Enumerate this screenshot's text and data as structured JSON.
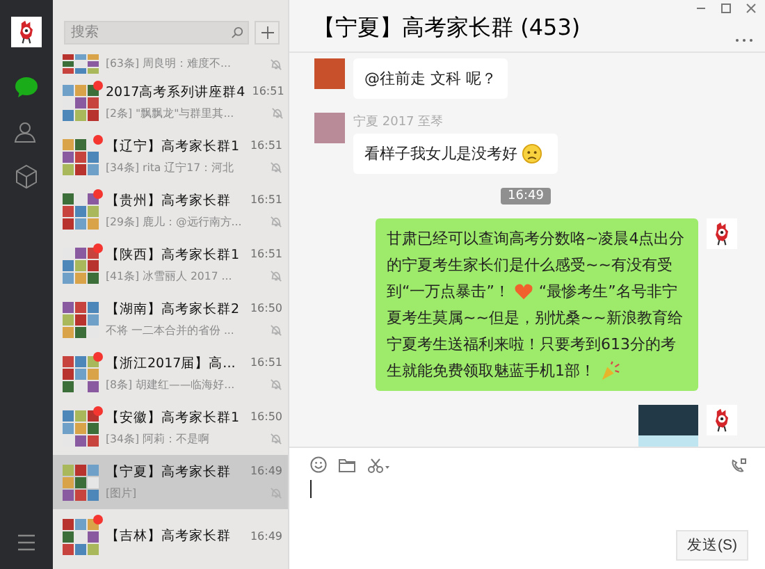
{
  "window": {
    "title": "【宁夏】高考家长群 (453)"
  },
  "search": {
    "placeholder": "搜索"
  },
  "chats": [
    {
      "kind": "partial",
      "preview": "[63条] 周良明：难度不...",
      "unread": false,
      "selected": false
    },
    {
      "kind": "full",
      "title": "2017高考系列讲座群4",
      "time": "16:51",
      "preview": "[2条] \"飘飘龙\"与群里其...",
      "unread": true,
      "selected": false
    },
    {
      "kind": "full",
      "title": "【辽宁】高考家长群1",
      "time": "16:51",
      "preview": "[34条] rita 辽宁17：河北",
      "unread": true,
      "selected": false
    },
    {
      "kind": "full",
      "title": "【贵州】高考家长群",
      "time": "16:51",
      "preview": "[29条] 鹿儿：@远行南方...",
      "unread": true,
      "selected": false
    },
    {
      "kind": "full",
      "title": "【陕西】高考家长群1",
      "time": "16:51",
      "preview": "[41条] 冰雪丽人  2017 ...",
      "unread": true,
      "selected": false
    },
    {
      "kind": "full",
      "title": "【湖南】高考家长群2",
      "time": "16:50",
      "preview": "不将 一二本合并的省份 ...",
      "unread": false,
      "selected": false
    },
    {
      "kind": "full",
      "title": "【浙江2017届】高...",
      "time": "16:51",
      "preview": "[8条] 胡建红——临海好...",
      "unread": true,
      "selected": false
    },
    {
      "kind": "full",
      "title": "【安徽】高考家长群1",
      "time": "16:50",
      "preview": "[34条] 阿莉：不是啊",
      "unread": true,
      "selected": false
    },
    {
      "kind": "full",
      "title": "【宁夏】高考家长群",
      "time": "16:49",
      "preview": "[图片]",
      "unread": false,
      "selected": true
    },
    {
      "kind": "full",
      "title": "【吉林】高考家长群",
      "time": "16:49",
      "unread": true,
      "selected": false
    }
  ],
  "messages": [
    {
      "kind": "text",
      "own": false,
      "parts": [
        {
          "kind": "text",
          "text": "@往前走 文科 呢？"
        }
      ]
    },
    {
      "kind": "text",
      "own": false,
      "sender": "宁夏 2017 至琴",
      "parts": [
        {
          "kind": "text",
          "text": "看样子我女儿是没考好"
        },
        {
          "kind": "sad"
        }
      ]
    },
    {
      "kind": "time",
      "text": "16:49"
    },
    {
      "kind": "text",
      "own": true,
      "parts": [
        {
          "kind": "text",
          "text": "甘肃已经可以查询高考分数咯~凌晨4点出分的宁夏考生家长们是什么感受~~有没有受到“一万点暴击”！"
        },
        {
          "kind": "heart"
        },
        {
          "kind": "text",
          "text": "“最惨考生”名号非宁夏考生莫属~~但是，别忧桑~~新浪教育给宁夏考生送福利来啦！只要考到613分的考生就能免费领取魅蓝手机1部！"
        },
        {
          "kind": "party"
        }
      ]
    },
    {
      "kind": "image",
      "own": true
    }
  ],
  "send_button": "发送(S)"
}
